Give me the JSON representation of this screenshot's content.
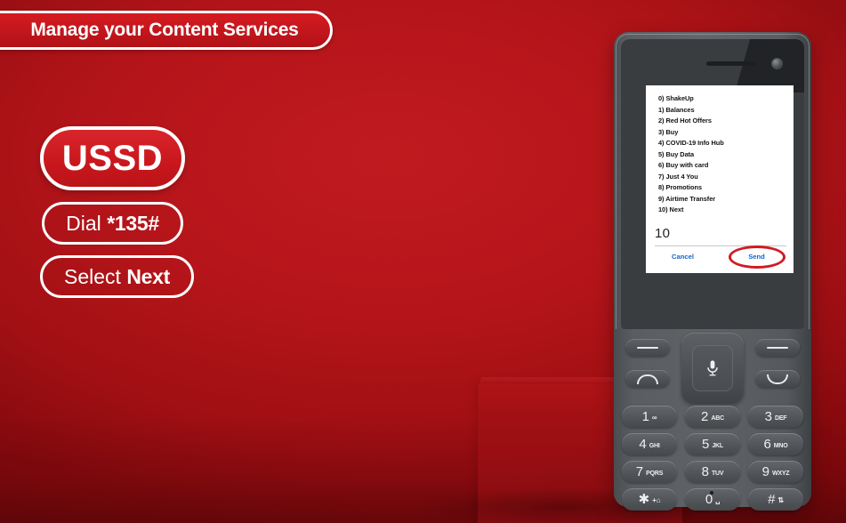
{
  "banner": {
    "title": "Manage your Content Services"
  },
  "steps": {
    "ussd_label": "USSD",
    "dial": {
      "prefix": "Dial ",
      "code": "*135#"
    },
    "select": {
      "prefix": "Select ",
      "target": "Next"
    }
  },
  "phone": {
    "screen": {
      "menu_items": [
        "0) ShakeUp",
        "1) Balances",
        "2) Red Hot Offers",
        "3) Buy",
        "4) COVID-19 Info Hub",
        "5) Buy Data",
        "6) Buy with card",
        "7) Just 4 You",
        "8) Promotions",
        "9) Airtime Transfer",
        "10) Next"
      ],
      "input_value": "10",
      "cancel_label": "Cancel",
      "send_label": "Send",
      "highlight_color": "#cf1c22",
      "action_color": "#1565c8"
    },
    "keypad": [
      [
        {
          "num": "1",
          "sub": "∞"
        },
        {
          "num": "2",
          "sub": "ABC"
        },
        {
          "num": "3",
          "sub": "DEF"
        }
      ],
      [
        {
          "num": "4",
          "sub": "GHI"
        },
        {
          "num": "5",
          "sub": "JKL"
        },
        {
          "num": "6",
          "sub": "MNO"
        }
      ],
      [
        {
          "num": "7",
          "sub": "PQRS"
        },
        {
          "num": "8",
          "sub": "TUV"
        },
        {
          "num": "9",
          "sub": "WXYZ"
        }
      ],
      [
        {
          "num": "✱",
          "sub": "+⌂"
        },
        {
          "num": "0",
          "sub": "␣"
        },
        {
          "num": "#",
          "sub": "⇅"
        }
      ]
    ]
  },
  "colors": {
    "background_red": "#b5151a",
    "pill_red": "#c8171d",
    "white": "#ffffff",
    "phone_body": "#5c6064"
  }
}
